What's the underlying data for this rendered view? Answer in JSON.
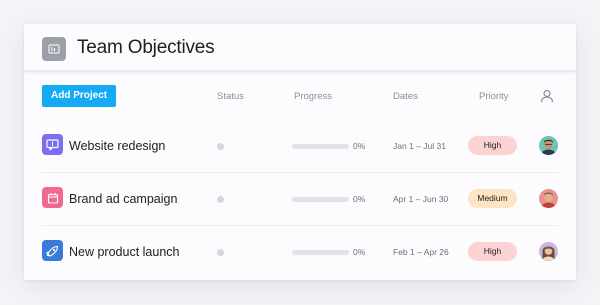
{
  "header": {
    "title": "Team Objectives",
    "icon": "board-icon"
  },
  "toolbar": {
    "add_label": "Add Project",
    "columns": {
      "status": "Status",
      "progress": "Progress",
      "dates": "Dates",
      "priority": "Priority"
    },
    "assignee_icon": "person-icon"
  },
  "colors": {
    "accent": "#14aaf5",
    "high_bg": "#fcd3d3",
    "medium_bg": "#fde5c4"
  },
  "rows": [
    {
      "name": "Website redesign",
      "icon": "chat-bubble-icon",
      "icon_color": "#7a6ff0",
      "progress": 0,
      "progress_label": "0%",
      "dates": "Jan 1 – Jul 31",
      "priority": "High",
      "priority_color": "#fcd3d3",
      "avatar": "avatar-man-glasses"
    },
    {
      "name": "Brand ad campaign",
      "icon": "calendar-icon",
      "icon_color": "#f06a8e",
      "progress": 0,
      "progress_label": "0%",
      "dates": "Apr 1 – Jun 30",
      "priority": "Medium",
      "priority_color": "#fde5c4",
      "avatar": "avatar-man-red"
    },
    {
      "name": "New product launch",
      "icon": "rocket-icon",
      "icon_color": "#3b7bd8",
      "progress": 0,
      "progress_label": "0%",
      "dates": "Feb 1 – Apr 26",
      "priority": "High",
      "priority_color": "#fcd3d3",
      "avatar": "avatar-woman"
    }
  ]
}
